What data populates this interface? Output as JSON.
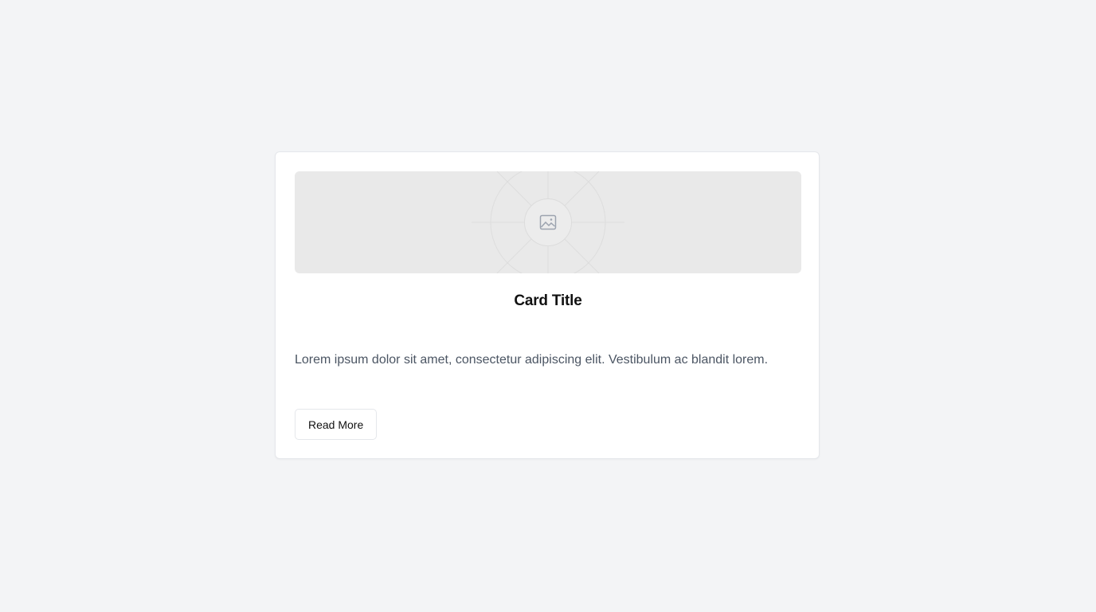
{
  "card": {
    "image_icon": "image-icon",
    "title": "Card Title",
    "description": "Lorem ipsum dolor sit amet, consectetur adipiscing elit. Vestibulum ac blandit lorem.",
    "button_label": "Read More"
  },
  "colors": {
    "page_background": "#f3f4f6",
    "card_background": "#ffffff",
    "placeholder_background": "#e9e9e9",
    "title_text": "#111111",
    "body_text": "#4b5563",
    "border": "#e5e7eb"
  }
}
